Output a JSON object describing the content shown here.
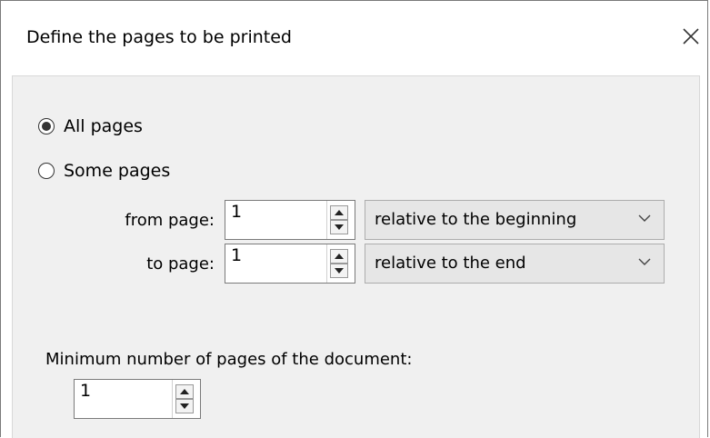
{
  "window": {
    "title": "Define the pages to be printed"
  },
  "options": {
    "all_pages": "All pages",
    "some_pages": "Some pages",
    "selected": "all_pages"
  },
  "range": {
    "from_label": "from page:",
    "from_value": "1",
    "from_relation": "relative to the beginning",
    "to_label": "to page:",
    "to_value": "1",
    "to_relation": "relative to the end"
  },
  "minimum": {
    "label": "Minimum number of pages of the document:",
    "value": "1"
  },
  "icons": {
    "close": "close-icon",
    "spin_up": "arrow-up-icon",
    "spin_down": "arrow-down-icon",
    "dropdown": "chevron-down-icon"
  }
}
